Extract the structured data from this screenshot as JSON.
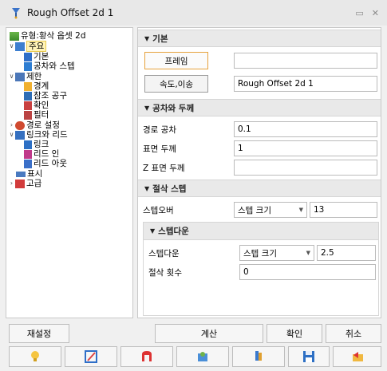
{
  "window": {
    "title": "Rough Offset 2d 1"
  },
  "tree": {
    "root": "유형:황삭 옵셋 2d",
    "items": [
      {
        "label": "주요"
      },
      {
        "label": "기본"
      },
      {
        "label": "공차와 스텝"
      },
      {
        "label": "제한"
      },
      {
        "label": "경계"
      },
      {
        "label": "참조 공구"
      },
      {
        "label": "확인"
      },
      {
        "label": "필터"
      },
      {
        "label": "경로 설정"
      },
      {
        "label": "링크와 리드"
      },
      {
        "label": "링크"
      },
      {
        "label": "리드 인"
      },
      {
        "label": "리드 아웃"
      },
      {
        "label": "표시"
      },
      {
        "label": "고급"
      }
    ]
  },
  "panel": {
    "basic": {
      "title": "기본",
      "frame_button": "프레임",
      "frame_value": "",
      "speed_button": "속도,이송",
      "name_value": "Rough Offset 2d 1"
    },
    "tolerance": {
      "title": "공차와 두께",
      "path_tol_label": "경로 공차",
      "path_tol_value": "0.1",
      "surface_label": "표면 두께",
      "surface_value": "1",
      "z_label": "Z 표면 두께",
      "z_value": ""
    },
    "cutting": {
      "title": "절삭 스텝",
      "stepover_label": "스텝오버",
      "stepover_mode": "스텝 크기",
      "stepover_value": "13",
      "stepdown_title": "스텝다운",
      "stepdown_label": "스텝다운",
      "stepdown_mode": "스텝 크기",
      "stepdown_value": "2.5",
      "passes_label": "절삭 횟수",
      "passes_value": "0"
    }
  },
  "buttons": {
    "reset": "재설정",
    "calculate": "계산",
    "ok": "확인",
    "cancel": "취소"
  }
}
